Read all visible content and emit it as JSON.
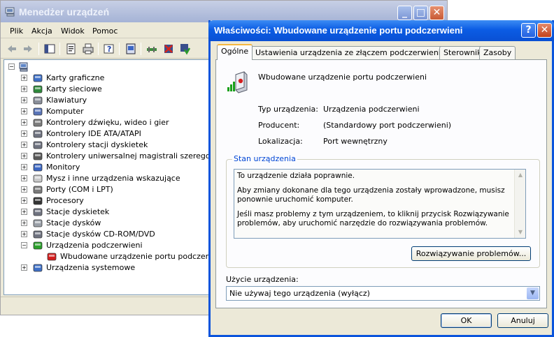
{
  "device_manager": {
    "title": "Menedżer urządzeń",
    "menu": [
      "Plik",
      "Akcja",
      "Widok",
      "Pomoc"
    ],
    "toolbar_icons": [
      "back-icon",
      "forward-icon",
      "tree-view-icon",
      "properties-icon",
      "print-icon",
      "help-icon",
      "update-driver-icon",
      "scan-hardware-icon",
      "uninstall-icon",
      "disable-icon"
    ],
    "tree": {
      "root_icon": "computer-icon",
      "categories": [
        {
          "label": "Karty graficzne",
          "icon": "display-adapter-icon"
        },
        {
          "label": "Karty sieciowe",
          "icon": "network-adapter-icon"
        },
        {
          "label": "Klawiatury",
          "icon": "keyboard-icon"
        },
        {
          "label": "Komputer",
          "icon": "computer-icon"
        },
        {
          "label": "Kontrolery dźwięku, wideo i gier",
          "icon": "sound-icon"
        },
        {
          "label": "Kontrolery IDE ATA/ATAPI",
          "icon": "ide-controller-icon"
        },
        {
          "label": "Kontrolery stacji dyskietek",
          "icon": "floppy-controller-icon"
        },
        {
          "label": "Kontrolery uniwersalnej magistrali szeregowej",
          "icon": "usb-icon"
        },
        {
          "label": "Monitory",
          "icon": "monitor-icon"
        },
        {
          "label": "Mysz i inne urządzenia wskazujące",
          "icon": "mouse-icon"
        },
        {
          "label": "Porty (COM i LPT)",
          "icon": "port-icon"
        },
        {
          "label": "Procesory",
          "icon": "processor-icon"
        },
        {
          "label": "Stacje dyskietek",
          "icon": "floppy-drive-icon"
        },
        {
          "label": "Stacje dysków",
          "icon": "disk-drive-icon"
        },
        {
          "label": "Stacje dysków CD-ROM/DVD",
          "icon": "cdrom-icon"
        },
        {
          "label": "Urządzenia podczerwieni",
          "icon": "infrared-icon",
          "expanded": true
        },
        {
          "label": "Wbudowane urządzenie portu podczerwieni",
          "icon": "infrared-device-icon",
          "child": true
        },
        {
          "label": "Urządzenia systemowe",
          "icon": "system-devices-icon"
        }
      ]
    }
  },
  "dialog": {
    "title": "Właściwości: Wbudowane urządzenie portu podczerwieni",
    "tabs": [
      "Ogólne",
      "Ustawienia urządzenia ze złączem podczerwieni (IrDA)",
      "Sterownik",
      "Zasoby"
    ],
    "active_tab": "Ogólne",
    "device_name": "Wbudowane urządzenie portu podczerwieni",
    "props": {
      "type_label": "Typ urządzenia:",
      "type_value": "Urządzenia podczerwieni",
      "maker_label": "Producent:",
      "maker_value": "(Standardowy port podczerwieni)",
      "location_label": "Lokalizacja:",
      "location_value": "Port wewnętrzny"
    },
    "status_group_title": "Stan urządzenia",
    "status_lines": [
      "To urządzenie działa poprawnie.",
      "Aby zmiany dokonane dla tego urządzenia zostały wprowadzone, musisz ponownie uruchomić komputer.",
      "Jeśli masz problemy z tym urządzeniem, to kliknij przycisk Rozwiązywanie problemów, aby uruchomić narzędzie do rozwiązywania problemów."
    ],
    "troubleshoot_button": "Rozwiązywanie problemów...",
    "usage_label": "Użycie urządzenia:",
    "usage_value": "Nie używaj tego urządzenia (wyłącz)",
    "ok_button": "OK",
    "cancel_button": "Anuluj"
  },
  "colors": {
    "xp_blue_title": "#0a54dc",
    "inactive_title": "#a5b3d6",
    "dialog_face": "#ece9d8",
    "groupbox_title": "#0046d5"
  }
}
